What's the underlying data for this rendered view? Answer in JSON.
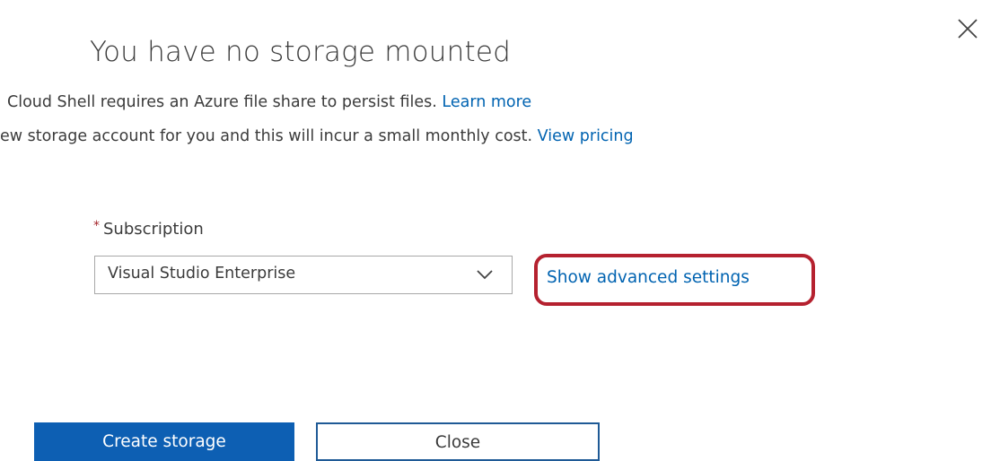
{
  "dialog": {
    "title": "You have no storage mounted",
    "description_line1": "Cloud Shell requires an Azure file share to persist files.",
    "learn_more_link": "Learn more",
    "description_line2": "ew storage account for you and this will incur a small monthly cost.",
    "view_pricing_link": "View pricing",
    "subscription_required_marker": "*",
    "subscription_label": "Subscription",
    "subscription_value": "Visual Studio Enterprise",
    "advanced_settings_link": "Show advanced settings",
    "create_button_label": "Create storage",
    "close_button_label": "Close"
  },
  "icons": {
    "close": "close-icon",
    "dropdown": "chevron-down-icon"
  },
  "colors": {
    "link": "#0063b1",
    "primary_button": "#0d5fb3",
    "highlight_annotation": "#b5212f",
    "required_marker": "#a4262c"
  }
}
